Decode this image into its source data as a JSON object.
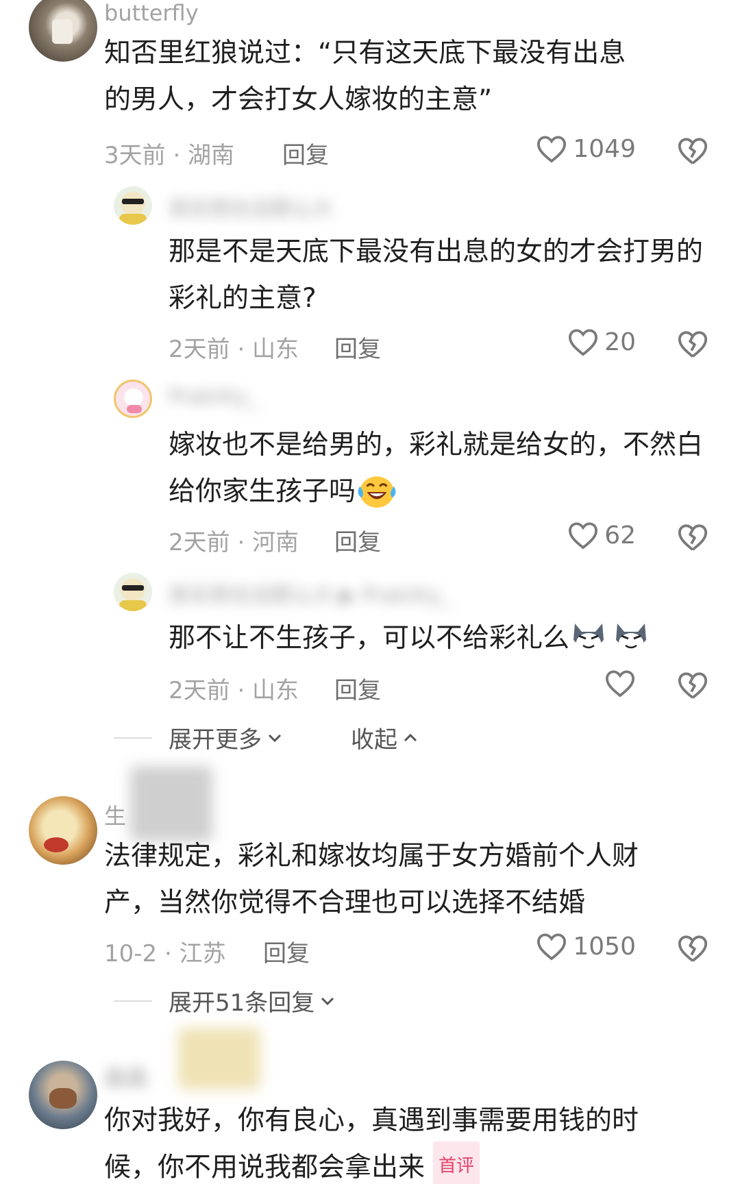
{
  "comments": [
    {
      "username": "butterfly",
      "text": "知否里红狼说过：“只有这天底下最没有出息的男人，才会打女人嫁妆的主意”",
      "meta": "3天前 · 湖南",
      "reply_label": "回复",
      "likes": "1049",
      "replies": [
        {
          "username": "其实雨也没那么大",
          "text": "那是不是天底下最没有出息的女的才会打男的彩礼的主意?",
          "meta": "2天前 · 山东",
          "reply_label": "回复",
          "likes": "20"
        },
        {
          "username": "Prakitty_",
          "text": "嫁妆也不是给男的，彩礼就是给女的，不然白给你家生孩子吗",
          "meta": "2天前 · 河南",
          "reply_label": "回复",
          "likes": "62"
        },
        {
          "username": "其实雨也没那么大 ▶ Prakitty_",
          "text": "那不让不生孩子，可以不给彩礼么",
          "meta": "2天前 · 山东",
          "reply_label": "回复",
          "likes": ""
        }
      ],
      "expand_more_label": "展开更多",
      "collapse_label": "收起"
    },
    {
      "username": "生",
      "text": "法律规定，彩礼和嫁妆均属于女方婚前个人财产，当然你觉得不合理也可以选择不结婚",
      "meta": "10-2 · 江苏",
      "reply_label": "回复",
      "likes": "1050",
      "expand_replies_label": "展开51条回复"
    },
    {
      "username": "鑫鑫",
      "text": "你对我好，你有良心，真遇到事需要用钱的时候，你不用说我都会拿出来",
      "badge": "首评"
    }
  ],
  "icons": {
    "like": "heart-outline-icon",
    "dislike": "broken-heart-icon",
    "chevron_down": "chevron-down-icon",
    "chevron_up": "chevron-up-icon"
  },
  "colors": {
    "meta_text": "#a3a3a3",
    "badge_text": "#e5436b",
    "badge_bg": "#fde6ec"
  }
}
